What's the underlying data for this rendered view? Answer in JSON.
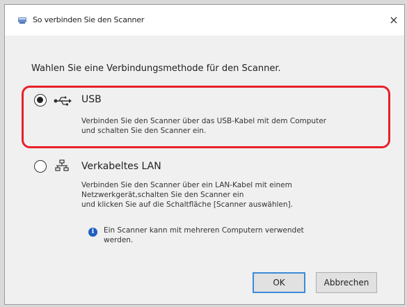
{
  "window": {
    "title": "So verbinden Sie den Scanner",
    "close_glyph": "×"
  },
  "prompt": "Wahlen Sie eine Verbindungsmethode für den Scanner.",
  "options": [
    {
      "label": "USB",
      "selected": true,
      "icon": "usb-icon",
      "description": "Verbinden Sie den Scanner über das USB-Kabel mit dem Computer\nund schalten Sie den Scanner ein."
    },
    {
      "label": "Verkabeltes LAN",
      "selected": false,
      "icon": "wired-lan-icon",
      "description": "Verbinden Sie den Scanner über ein LAN-Kabel mit einem\nNetzwerkgerät,schalten Sie den Scanner ein\nund klicken Sie auf die Schaltfläche [Scanner auswählen]."
    }
  ],
  "info": {
    "icon": "info-icon",
    "glyph": "i",
    "text": "Ein Scanner kann mit mehreren Computern verwendet\nwerden."
  },
  "buttons": {
    "ok": "OK",
    "cancel": "Abbrechen"
  },
  "colors": {
    "highlight": "#e8202a",
    "info": "#1f5fbf",
    "default_button_border": "#3c8ad8"
  }
}
